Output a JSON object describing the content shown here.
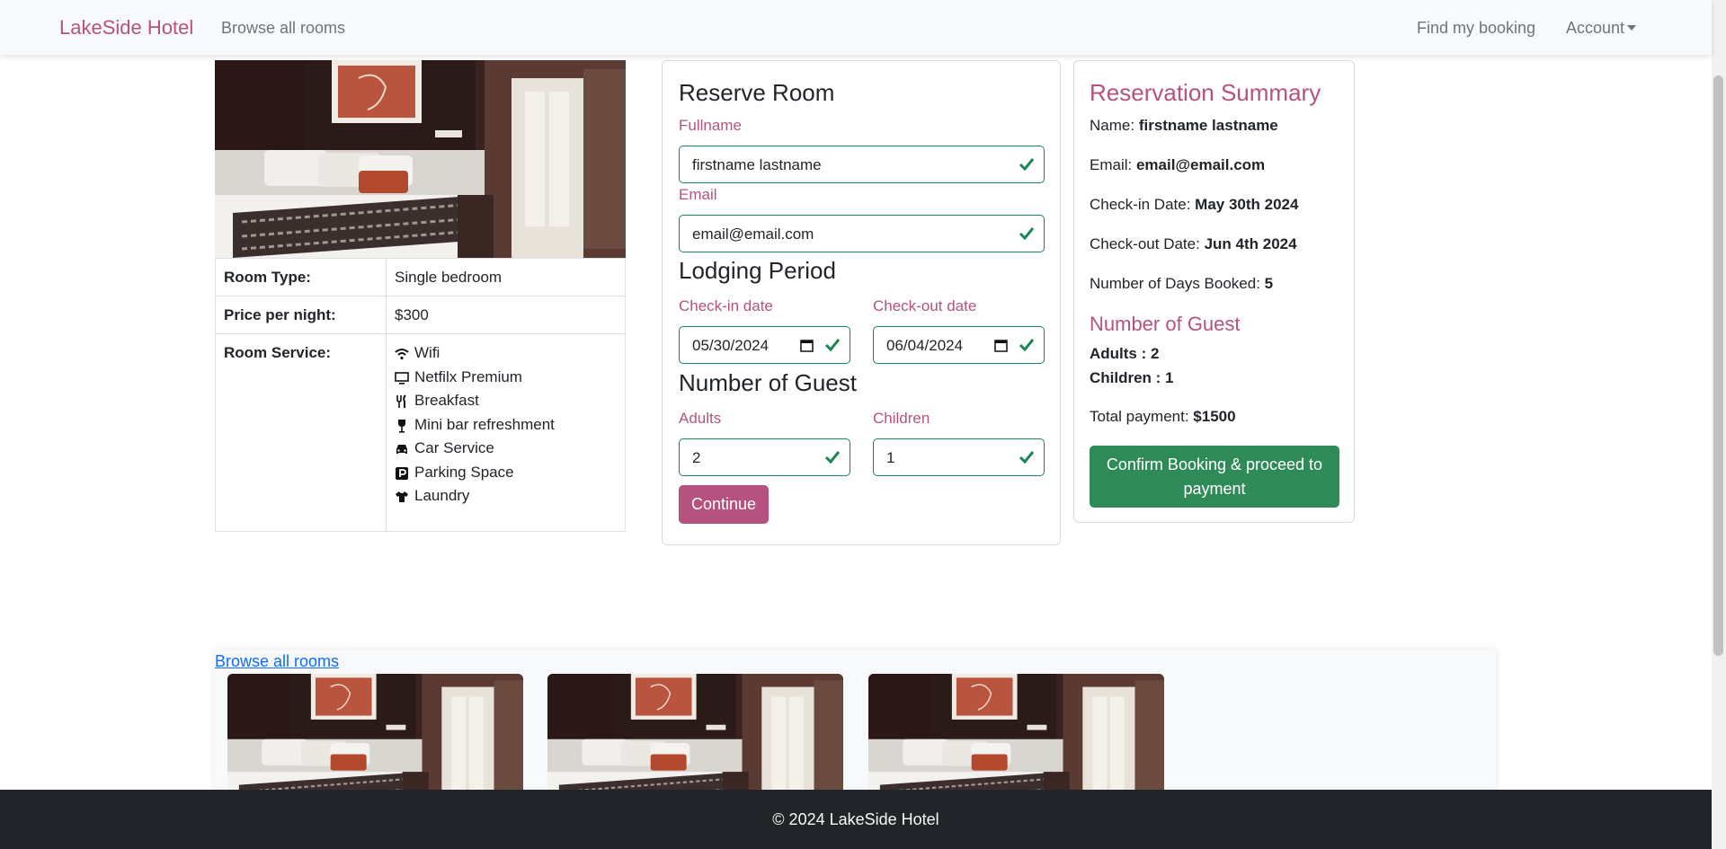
{
  "nav": {
    "brand": "LakeSide Hotel",
    "browse": "Browse all rooms",
    "find": "Find my booking",
    "account": "Account"
  },
  "room": {
    "table": [
      {
        "key": "Room Type:",
        "value": "Single bedroom"
      },
      {
        "key": "Price per night:",
        "value": "$300"
      }
    ],
    "service_key": "Room Service:",
    "services": [
      {
        "label": "Wifi",
        "icon": "wifi-icon"
      },
      {
        "label": "Netfilx Premium",
        "icon": "tv-icon"
      },
      {
        "label": "Breakfast",
        "icon": "utensils-icon"
      },
      {
        "label": "Mini bar refreshment",
        "icon": "wine-glass-icon"
      },
      {
        "label": "Car Service",
        "icon": "car-icon"
      },
      {
        "label": "Parking Space",
        "icon": "parking-icon"
      },
      {
        "label": "Laundry",
        "icon": "tshirt-icon"
      }
    ]
  },
  "reserve": {
    "title": "Reserve Room",
    "fullname_label": "Fullname",
    "fullname_value": "firstname lastname",
    "email_label": "Email",
    "email_value": "email@email.com",
    "lodging_title": "Lodging Period",
    "checkin_label": "Check-in date",
    "checkin_value": "05/30/2024",
    "checkout_label": "Check-out date",
    "checkout_value": "06/04/2024",
    "guest_title": "Number of Guest",
    "adults_label": "Adults",
    "adults_value": "2",
    "children_label": "Children",
    "children_value": "1",
    "continue_label": "Continue"
  },
  "summary": {
    "title": "Reservation Summary",
    "name_label": "Name:",
    "name_value": "firstname lastname",
    "email_label": "Email:",
    "email_value": "email@email.com",
    "checkin_label": "Check-in Date:",
    "checkin_value": "May 30th 2024",
    "checkout_label": "Check-out Date:",
    "checkout_value": "Jun 4th 2024",
    "days_label": "Number of Days Booked:",
    "days_value": "5",
    "guest_title": "Number of Guest",
    "adults_text": "Adults : 2",
    "children_text": "Children : 1",
    "total_label": "Total payment:",
    "total_value": "$1500",
    "confirm_label": "Confirm Booking & proceed to payment"
  },
  "related": {
    "browse_link": "Browse all rooms"
  },
  "footer": {
    "text": "© 2024 LakeSide Hotel"
  },
  "colors": {
    "brand": "#b5527f",
    "valid_green": "#198754",
    "confirm_green": "#2e8b57",
    "footer_bg": "#212529",
    "link_blue": "#0d6efd"
  }
}
